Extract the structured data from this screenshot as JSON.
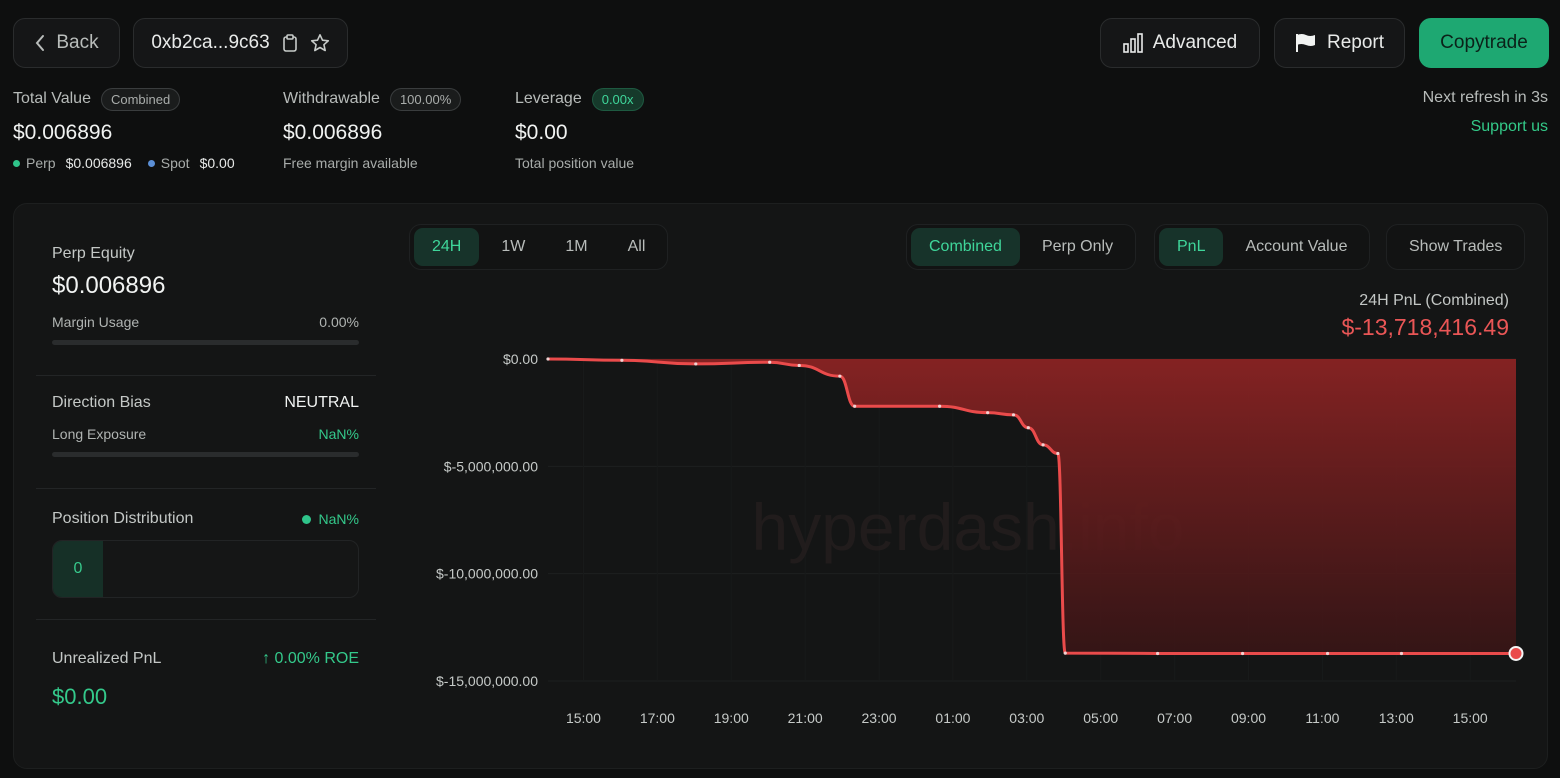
{
  "header": {
    "back_label": "Back",
    "address": "0xb2ca...9c63",
    "advanced_label": "Advanced",
    "report_label": "Report",
    "copytrade_label": "Copytrade"
  },
  "stats": {
    "total_value": {
      "label": "Total Value",
      "badge": "Combined",
      "value": "$0.006896",
      "perp_label": "Perp",
      "perp_value": "$0.006896",
      "spot_label": "Spot",
      "spot_value": "$0.00"
    },
    "withdrawable": {
      "label": "Withdrawable",
      "badge": "100.00%",
      "value": "$0.006896",
      "sub": "Free margin available"
    },
    "leverage": {
      "label": "Leverage",
      "badge": "0.00x",
      "value": "$0.00",
      "sub": "Total position value"
    }
  },
  "refresh_text": "Next refresh in 3s",
  "support_text": "Support us",
  "sidebar": {
    "perp_equity": {
      "label": "Perp Equity",
      "value": "$0.006896",
      "margin_label": "Margin Usage",
      "margin_value": "0.00%",
      "margin_fraction": 0
    },
    "direction": {
      "label": "Direction Bias",
      "value": "NEUTRAL",
      "long_label": "Long Exposure",
      "long_value": "NaN%",
      "long_fraction": 0
    },
    "distribution": {
      "label": "Position Distribution",
      "value": "NaN%",
      "count": "0"
    },
    "unrealized": {
      "label": "Unrealized PnL",
      "roe": "↑ 0.00% ROE",
      "value": "$0.00"
    }
  },
  "controls": {
    "ranges": [
      "24H",
      "1W",
      "1M",
      "All"
    ],
    "range_selected": "24H",
    "scope": [
      "Combined",
      "Perp Only"
    ],
    "scope_selected": "Combined",
    "metric": [
      "PnL",
      "Account Value"
    ],
    "metric_selected": "PnL",
    "show_trades_label": "Show Trades"
  },
  "chart_summary": {
    "label": "24H PnL (Combined)",
    "value": "$-13,718,416.49"
  },
  "watermark": "hyperdash.info",
  "colors": {
    "accent": "#1ea872",
    "negative": "#e84a4a",
    "positive_text": "#3fd69a"
  },
  "chart_data": {
    "type": "area",
    "title": "24H PnL (Combined)",
    "xlabel": "",
    "ylabel": "",
    "x_ticks": [
      "15:00",
      "17:00",
      "19:00",
      "21:00",
      "23:00",
      "01:00",
      "03:00",
      "05:00",
      "07:00",
      "09:00",
      "11:00",
      "13:00",
      "15:00"
    ],
    "y_ticks": [
      {
        "value": 0,
        "label": "$0.00"
      },
      {
        "value": -5000000,
        "label": "$-5,000,000.00"
      },
      {
        "value": -10000000,
        "label": "$-10,000,000.00"
      },
      {
        "value": -15000000,
        "label": "$-15,000,000.00"
      }
    ],
    "ylim": [
      -15000000,
      0
    ],
    "x_range_hours": [
      -0.5,
      25.7
    ],
    "series": [
      {
        "points": [
          [
            -0.5,
            0
          ],
          [
            1.5,
            -60000
          ],
          [
            3.5,
            -230000
          ],
          [
            5.5,
            -150000
          ],
          [
            6.3,
            -300000
          ],
          [
            7.4,
            -800000
          ],
          [
            7.8,
            -2200000
          ],
          [
            10.1,
            -2200000
          ],
          [
            11.4,
            -2500000
          ],
          [
            12.1,
            -2600000
          ],
          [
            12.5,
            -3200000
          ],
          [
            12.9,
            -4000000
          ],
          [
            13.3,
            -4400000
          ],
          [
            13.5,
            -13700000
          ],
          [
            16.0,
            -13718416
          ],
          [
            18.3,
            -13718416
          ],
          [
            20.6,
            -13718416
          ],
          [
            22.6,
            -13718416
          ],
          [
            25.7,
            -13718416
          ]
        ]
      }
    ],
    "grid": true,
    "legend": "none"
  }
}
